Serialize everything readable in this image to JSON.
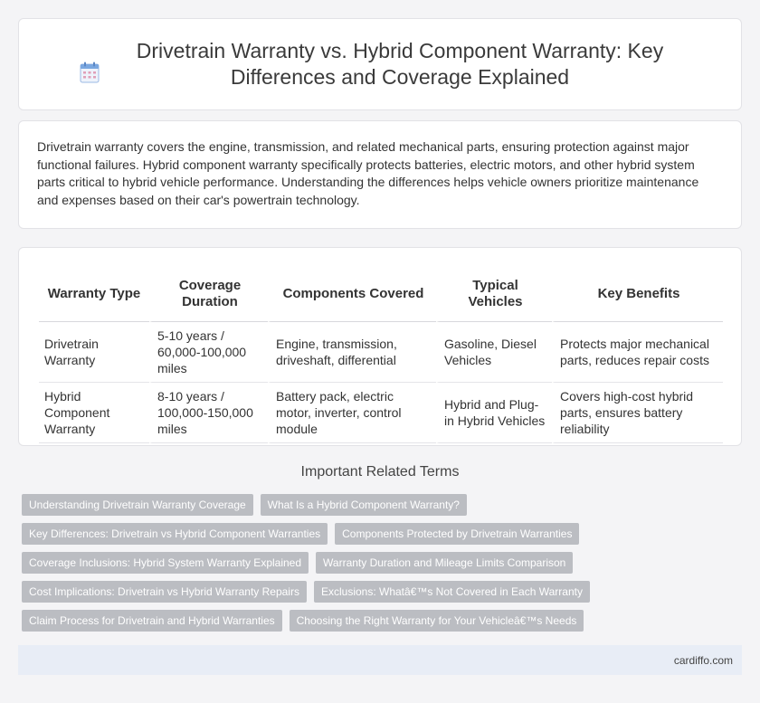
{
  "header": {
    "title": "Drivetrain Warranty vs. Hybrid Component Warranty: Key Differences and Coverage Explained",
    "icon": "calendar-icon"
  },
  "intro": {
    "text": "Drivetrain warranty covers the engine, transmission, and related mechanical parts, ensuring protection against major functional failures. Hybrid component warranty specifically protects batteries, electric motors, and other hybrid system parts critical to hybrid vehicle performance. Understanding the differences helps vehicle owners prioritize maintenance and expenses based on their car's powertrain technology."
  },
  "table": {
    "headers": [
      "Warranty Type",
      "Coverage Duration",
      "Components Covered",
      "Typical Vehicles",
      "Key Benefits"
    ],
    "rows": [
      [
        "Drivetrain Warranty",
        "5-10 years / 60,000-100,000 miles",
        "Engine, transmission, driveshaft, differential",
        "Gasoline, Diesel Vehicles",
        "Protects major mechanical parts, reduces repair costs"
      ],
      [
        "Hybrid Component Warranty",
        "8-10 years / 100,000-150,000 miles",
        "Battery pack, electric motor, inverter, control module",
        "Hybrid and Plug-in Hybrid Vehicles",
        "Covers high-cost hybrid parts, ensures battery reliability"
      ]
    ]
  },
  "related": {
    "title": "Important Related Terms",
    "tags": [
      [
        "Understanding Drivetrain Warranty Coverage",
        "What Is a Hybrid Component Warranty?"
      ],
      [
        "Key Differences: Drivetrain vs Hybrid Component Warranties",
        "Components Protected by Drivetrain Warranties"
      ],
      [
        "Coverage Inclusions: Hybrid System Warranty Explained",
        "Warranty Duration and Mileage Limits Comparison"
      ],
      [
        "Cost Implications: Drivetrain vs Hybrid Warranty Repairs",
        "Exclusions: Whatâ€™s Not Covered in Each Warranty"
      ],
      [
        "Claim Process for Drivetrain and Hybrid Warranties",
        "Choosing the Right Warranty for Your Vehicleâ€™s Needs"
      ]
    ]
  },
  "footer": {
    "site": "cardiffo.com"
  },
  "colors": {
    "tag_bg": "#bbbdc2",
    "footer_bg": "#e8edf6",
    "icon_blue": "#7aa7e0"
  }
}
